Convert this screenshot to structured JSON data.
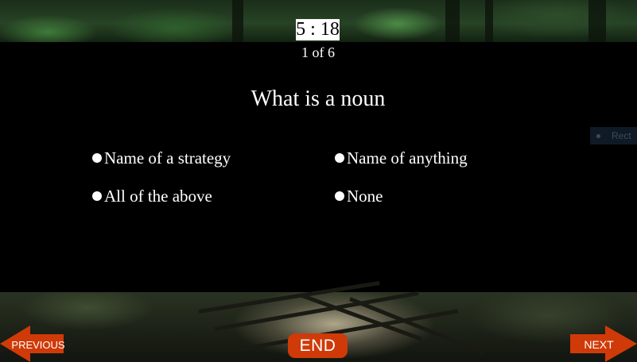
{
  "timer": {
    "value": "5 : 18"
  },
  "progress": {
    "text": "1 of 6"
  },
  "question": {
    "text": "What is a noun"
  },
  "options": [
    {
      "label": "Name of a strategy"
    },
    {
      "label": "Name of anything"
    },
    {
      "label": "All of the above"
    },
    {
      "label": "None"
    }
  ],
  "nav": {
    "previous_label": "PREVIOUS",
    "next_label": "NEXT",
    "end_label": "END"
  },
  "artifact": {
    "text": "Rect"
  },
  "colors": {
    "button_orange": "#cf3a08",
    "panel_background": "#000000",
    "timer_background": "#ffffff",
    "text": "#ffffff"
  }
}
